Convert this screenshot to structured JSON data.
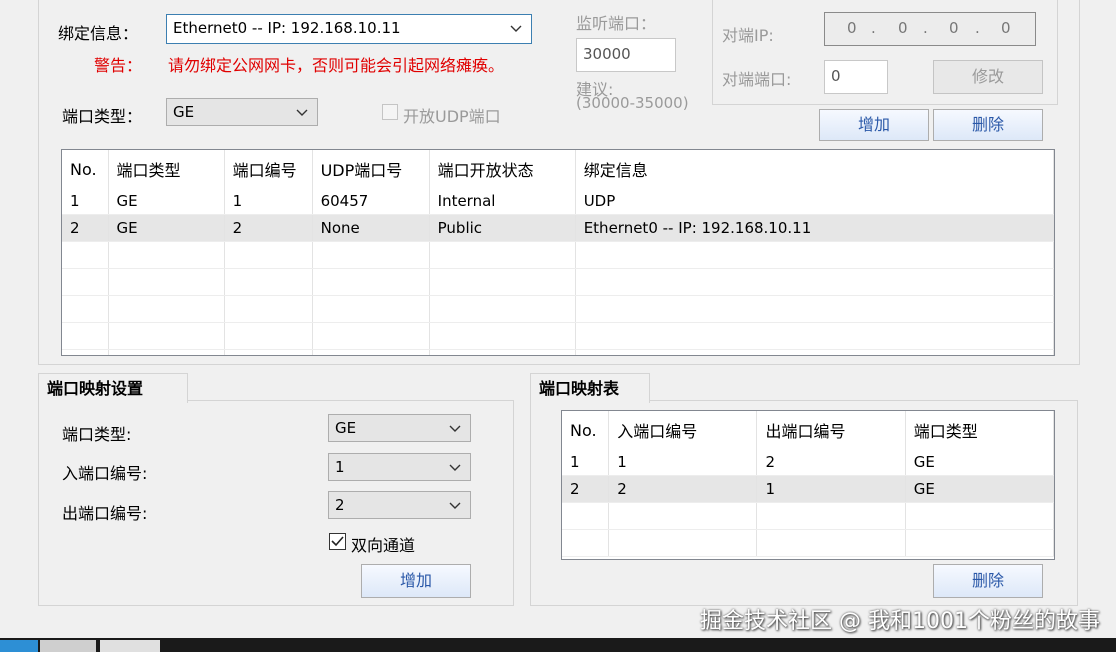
{
  "binding": {
    "label": "绑定信息：",
    "value": "Ethernet0 -- IP: 192.168.10.11",
    "warning_label": "警告：",
    "warning_text": "请勿绑定公网网卡，否则可能会引起网络瘫痪。"
  },
  "port_type": {
    "label": "端口类型：",
    "value": "GE"
  },
  "udp_checkbox": {
    "label": "开放UDP端口",
    "checked": false
  },
  "listen_port": {
    "label": "监听端口：",
    "value": "30000",
    "hint_line1": "建议:",
    "hint_line2": "(30000-35000)"
  },
  "peer": {
    "ip_label": "对端IP:",
    "ip_octets": [
      "0",
      "0",
      "0",
      "0"
    ],
    "port_label": "对端端口:",
    "port_value": "0",
    "modify_button": "修改"
  },
  "top_buttons": {
    "add": "增加",
    "delete": "删除"
  },
  "ports_table": {
    "headers": [
      "No.",
      "端口类型",
      "端口编号",
      "UDP端口号",
      "端口开放状态",
      "绑定信息"
    ],
    "rows": [
      [
        "1",
        "GE",
        "1",
        "60457",
        "Internal",
        "UDP"
      ],
      [
        "2",
        "GE",
        "2",
        "None",
        "Public",
        "Ethernet0 -- IP: 192.168.10.11"
      ]
    ]
  },
  "mapping_settings": {
    "title": "端口映射设置",
    "type_label": "端口类型:",
    "type_value": "GE",
    "in_label": "入端口编号:",
    "in_value": "1",
    "out_label": "出端口编号:",
    "out_value": "2",
    "bidirectional_label": "双向通道",
    "bidirectional_checked": true,
    "add_button": "增加"
  },
  "mapping_table": {
    "title": "端口映射表",
    "headers": [
      "No.",
      "入端口编号",
      "出端口编号",
      "端口类型"
    ],
    "rows": [
      [
        "1",
        "1",
        "2",
        "GE"
      ],
      [
        "2",
        "2",
        "1",
        "GE"
      ]
    ],
    "delete_button": "删除"
  },
  "watermark": "掘金技术社区 @ 我和1001个粉丝的故事",
  "colors": {
    "accent": "#3c7fb1",
    "warning": "#e00000",
    "button_text": "#2a58a8"
  }
}
